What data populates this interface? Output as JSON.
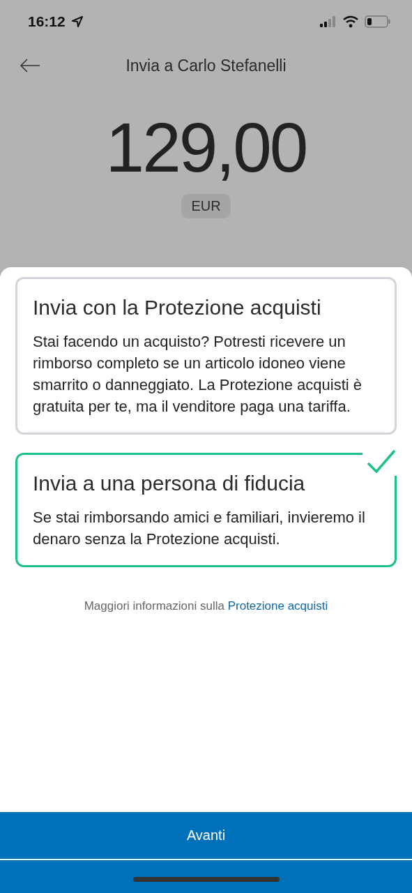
{
  "status_bar": {
    "time": "16:12"
  },
  "header": {
    "title": "Invia a Carlo Stefanelli"
  },
  "amount": {
    "value": "129,00",
    "currency": "EUR"
  },
  "options": [
    {
      "title": "Invia con la Protezione acquisti",
      "description": "Stai facendo un acquisto? Potresti ricevere un rimborso completo se un articolo idoneo viene smarrito o danneggiato. La Protezione acquisti è gratuita per te, ma il venditore paga una tariffa.",
      "selected": false
    },
    {
      "title": "Invia a una persona di fiducia",
      "description": "Se stai rimborsando amici e familiari, invieremo il denaro senza la Protezione acquisti.",
      "selected": true
    }
  ],
  "info": {
    "text": "Maggiori informazioni sulla",
    "link": "Protezione acquisti"
  },
  "primary_button": {
    "label": "Avanti"
  }
}
